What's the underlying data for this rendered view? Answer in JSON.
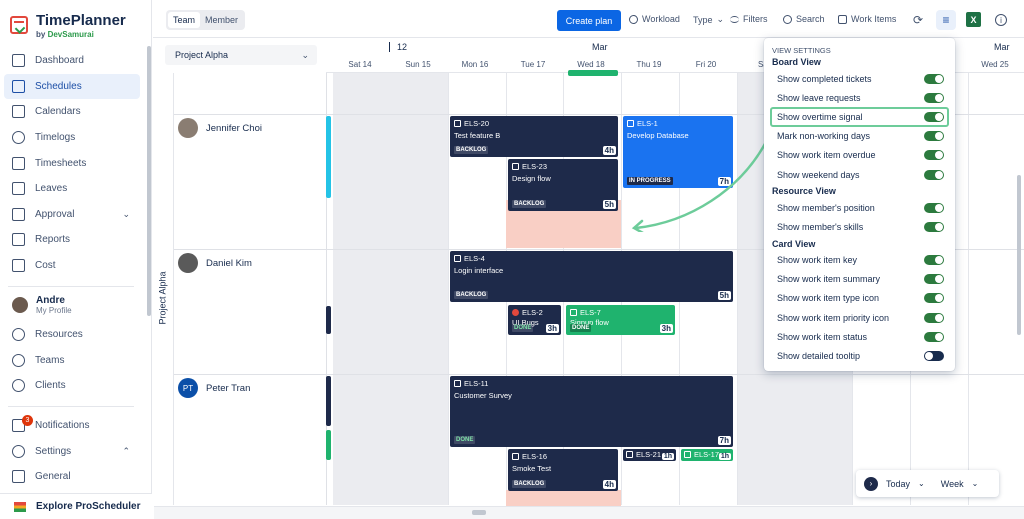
{
  "app": {
    "title": "TimePlanner",
    "by": "by",
    "vendor": "DevSamurai"
  },
  "sidebar": {
    "items": [
      {
        "label": "Dashboard",
        "icon": "dashboard-icon"
      },
      {
        "label": "Schedules",
        "icon": "schedules-icon",
        "active": true
      },
      {
        "label": "Calendars",
        "icon": "calendar-icon"
      },
      {
        "label": "Timelogs",
        "icon": "clock-icon"
      },
      {
        "label": "Timesheets",
        "icon": "grid-icon"
      },
      {
        "label": "Leaves",
        "icon": "leave-icon"
      },
      {
        "label": "Approval",
        "icon": "approval-icon"
      },
      {
        "label": "Reports",
        "icon": "reports-icon"
      },
      {
        "label": "Cost",
        "icon": "cost-icon"
      }
    ],
    "profile": {
      "name": "Andre",
      "sub": "My Profile"
    },
    "items2": [
      {
        "label": "Resources"
      },
      {
        "label": "Teams"
      },
      {
        "label": "Clients"
      },
      {
        "label": "Notifications",
        "badge": "3"
      },
      {
        "label": "Settings"
      },
      {
        "label": "General"
      }
    ],
    "explore": "Explore ProScheduler"
  },
  "toolbar": {
    "team": "Team",
    "member": "Member",
    "create_plan": "Create plan",
    "workload": "Workload",
    "type": "Type",
    "filters": "Filters",
    "search": "Search",
    "work_items": "Work Items",
    "excel": "X",
    "info": "i"
  },
  "project": {
    "selected": "Project Alpha",
    "vertical_label": "Project Alpha"
  },
  "calendar": {
    "week_label": "12",
    "month_label": "Mar",
    "month_label_right": "Mar",
    "days": [
      "Sat 14",
      "Sun 15",
      "Mon 16",
      "Tue 17",
      "Wed 18",
      "Thu 19",
      "Fri 20",
      "Sat",
      "Wed 25"
    ]
  },
  "members": [
    {
      "name": "Jennifer Choi"
    },
    {
      "name": "Daniel Kim"
    },
    {
      "name": "Peter Tran",
      "initials": "PT"
    }
  ],
  "tasks": {
    "els20": {
      "key": "ELS-20",
      "summary": "Test feature B",
      "status": "BACKLOG",
      "hours": "4h"
    },
    "els1": {
      "key": "ELS-1",
      "summary": "Develop Database",
      "status": "IN PROGRESS",
      "hours": "7h"
    },
    "els23": {
      "key": "ELS-23",
      "summary": "Design flow",
      "status": "BACKLOG",
      "hours": "5h"
    },
    "els4": {
      "key": "ELS-4",
      "summary": "Login interface",
      "status": "BACKLOG",
      "hours": "5h"
    },
    "els2": {
      "key": "ELS-2",
      "summary": "UI Bugs",
      "status": "DONE",
      "hours": "3h"
    },
    "els7": {
      "key": "ELS-7",
      "summary": "Signup flow",
      "status": "DONE",
      "hours": "3h"
    },
    "els11": {
      "key": "ELS-11",
      "summary": "Customer Survey",
      "status": "DONE",
      "hours": "7h"
    },
    "els16": {
      "key": "ELS-16",
      "summary": "Smoke Test",
      "status": "BACKLOG",
      "hours": "4h"
    },
    "els21": {
      "key": "ELS-21",
      "hours": "1h"
    },
    "els17": {
      "key": "ELS-17",
      "hours": "1h"
    }
  },
  "view_settings": {
    "header": "VIEW SETTINGS",
    "board_title": "Board View",
    "board": [
      {
        "label": "Show completed tickets",
        "on": true
      },
      {
        "label": "Show leave requests",
        "on": true
      },
      {
        "label": "Show overtime signal",
        "on": true,
        "highlight": true
      },
      {
        "label": "Mark non-working days",
        "on": true
      },
      {
        "label": "Show work item overdue",
        "on": true
      },
      {
        "label": "Show weekend days",
        "on": true
      }
    ],
    "resource_title": "Resource View",
    "resource": [
      {
        "label": "Show member's position",
        "on": true
      },
      {
        "label": "Show member's skills",
        "on": true
      }
    ],
    "card_title": "Card View",
    "card": [
      {
        "label": "Show work item key",
        "on": true
      },
      {
        "label": "Show work item summary",
        "on": true
      },
      {
        "label": "Show work item type icon",
        "on": true
      },
      {
        "label": "Show work item priority icon",
        "on": true
      },
      {
        "label": "Show work item status",
        "on": true
      },
      {
        "label": "Show detailed tooltip",
        "on": false
      }
    ]
  },
  "date_controls": {
    "today": "Today",
    "week": "Week"
  },
  "colors": {
    "primary": "#0b66e4",
    "task_navy": "#1e2a4a",
    "task_blue": "#1a73f0",
    "task_green": "#1fb36e",
    "overtime": "#f9cfc5",
    "highlight": "#6dcc9a"
  }
}
